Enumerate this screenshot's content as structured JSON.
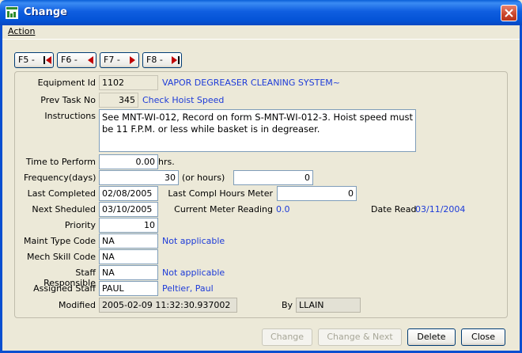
{
  "window": {
    "title": "Change"
  },
  "menu": {
    "action": "Action"
  },
  "nav": [
    {
      "label": "F5 -",
      "icon": "first-record-icon"
    },
    {
      "label": "F6 -",
      "icon": "previous-record-icon"
    },
    {
      "label": "F7 -",
      "icon": "next-record-icon"
    },
    {
      "label": "F8 -",
      "icon": "last-record-icon"
    }
  ],
  "form": {
    "equipment_id": {
      "label": "Equipment Id",
      "value": "1102",
      "desc": "VAPOR DEGREASER CLEANING SYSTEM~"
    },
    "prev_task": {
      "label": "Prev Task No",
      "value": "345",
      "desc": "Check Hoist Speed"
    },
    "instructions": {
      "label": "Instructions",
      "value": "See MNT-WI-012, Record on form S-MNT-WI-012-3.  Hoist speed must be 11 F.P.M. or less while basket is in degreaser."
    },
    "time_to_perform": {
      "label": "Time to Perform",
      "value": "0.00",
      "unit": "hrs."
    },
    "frequency": {
      "label": "Frequency(days)",
      "value": "30",
      "or_label": "(or hours)",
      "hours_value": "0"
    },
    "last_completed": {
      "label": "Last Completed",
      "value": "02/08/2005"
    },
    "last_compl_hours": {
      "label": "Last Compl Hours Meter",
      "value": "0"
    },
    "next_scheduled": {
      "label": "Next Sheduled",
      "value": "03/10/2005"
    },
    "current_meter": {
      "label": "Current Meter Reading",
      "value": "0.0"
    },
    "date_read": {
      "label": "Date Read",
      "value": "03/11/2004"
    },
    "priority": {
      "label": "Priority",
      "value": "10"
    },
    "maint_type": {
      "label": "Maint Type Code",
      "value": "NA",
      "desc": "Not applicable"
    },
    "mech_skill": {
      "label": "Mech Skill Code",
      "value": "NA"
    },
    "staff_responsible": {
      "label": "Staff Responsible",
      "value": "NA",
      "desc": "Not applicable"
    },
    "assigned_staff": {
      "label": "Assigned Staff",
      "value": "PAUL",
      "desc": "Peltier, Paul"
    },
    "modified": {
      "label": "Modified",
      "value": "2005-02-09 11:32:30.937002"
    },
    "by": {
      "label": "By",
      "value": "LLAIN"
    }
  },
  "buttons": {
    "change": "Change",
    "change_next": "Change & Next",
    "delete": "Delete",
    "close": "Close"
  },
  "colors": {
    "titlebar": "#0453d6",
    "link_text": "#1d3bd8",
    "window_bg": "#ece9d8"
  }
}
